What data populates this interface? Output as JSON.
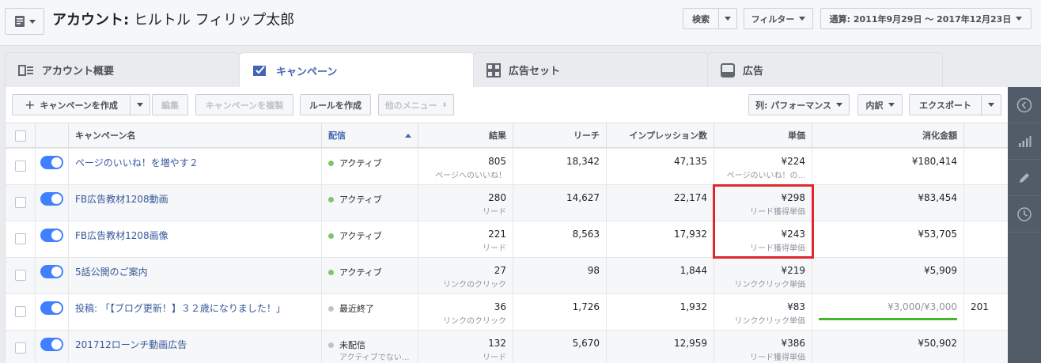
{
  "header": {
    "account_label": "アカウント:",
    "account_name": "ヒルトル フィリップ太郎",
    "search_label": "検索",
    "filter_label": "フィルター",
    "date_range_label": "通算: 2011年9月29日 ～ 2017年12月23日"
  },
  "tabs": [
    {
      "label": "アカウント概要",
      "icon": "account-overview-icon"
    },
    {
      "label": "キャンペーン",
      "icon": "campaign-check-icon"
    },
    {
      "label": "広告セット",
      "icon": "grid-icon"
    },
    {
      "label": "広告",
      "icon": "ad-icon"
    }
  ],
  "toolbar": {
    "create_label": "キャンペーンを作成",
    "edit_label": "編集",
    "duplicate_label": "キャンペーンを複製",
    "rule_label": "ルールを作成",
    "other_menu_label": "他のメニュー",
    "columns_label": "列: パフォーマンス",
    "breakdown_label": "内訳",
    "export_label": "エクスポート"
  },
  "table": {
    "headers": {
      "name": "キャンペーン名",
      "delivery": "配信",
      "results": "結果",
      "reach": "リーチ",
      "impressions": "インプレッション数",
      "cost": "単価",
      "spent": "消化金額"
    },
    "rows": [
      {
        "name": "ページのいいね！を増やす２",
        "status": "アクティブ",
        "status_sub": "",
        "status_color": "#7fc56b",
        "results": "805",
        "results_sub": "ページへのいいね！",
        "reach": "18,342",
        "impressions": "47,135",
        "cost": "¥224",
        "cost_sub": "ページのいいね！の...",
        "spent": "¥180,414",
        "extra": ""
      },
      {
        "name": "FB広告教材1208動画",
        "status": "アクティブ",
        "status_sub": "",
        "status_color": "#7fc56b",
        "results": "280",
        "results_sub": "リード",
        "reach": "14,627",
        "impressions": "22,174",
        "cost": "¥298",
        "cost_sub": "リード獲得単価",
        "spent": "¥83,454",
        "extra": ""
      },
      {
        "name": "FB広告教材1208画像",
        "status": "アクティブ",
        "status_sub": "",
        "status_color": "#7fc56b",
        "results": "221",
        "results_sub": "リード",
        "reach": "8,563",
        "impressions": "17,932",
        "cost": "¥243",
        "cost_sub": "リード獲得単価",
        "spent": "¥53,705",
        "extra": ""
      },
      {
        "name": "5話公開のご案内",
        "status": "アクティブ",
        "status_sub": "",
        "status_color": "#7fc56b",
        "results": "27",
        "results_sub": "リンクのクリック",
        "reach": "98",
        "impressions": "1,844",
        "cost": "¥219",
        "cost_sub": "リンククリック単価",
        "spent": "¥5,909",
        "extra": ""
      },
      {
        "name": "投稿: 「【ブログ更新！】３２歳になりました！」",
        "status": "最近終了",
        "status_sub": "",
        "status_color": "#bec3c9",
        "results": "36",
        "results_sub": "リンクのクリック",
        "reach": "1,726",
        "impressions": "1,932",
        "cost": "¥83",
        "cost_sub": "リンククリック単価",
        "spent": "¥3,000/¥3,000",
        "spent_progress": 1.0,
        "extra": "201"
      },
      {
        "name": "201712ローンチ動画広告",
        "status": "未配信",
        "status_sub": "アクティブでない...",
        "status_color": "#bec3c9",
        "results": "132",
        "results_sub": "リード",
        "reach": "5,670",
        "impressions": "12,959",
        "cost": "¥386",
        "cost_sub": "リード獲得単価",
        "spent": "¥50,902",
        "extra": ""
      }
    ]
  },
  "colors": {
    "accent": "#4267b2",
    "link": "#365899",
    "toggle_on": "#4080ff",
    "highlight": "#e0282c",
    "progress": "#42b72a"
  },
  "rail_icons": [
    "chevron-left-icon",
    "bar-chart-icon",
    "pencil-icon",
    "clock-icon"
  ]
}
